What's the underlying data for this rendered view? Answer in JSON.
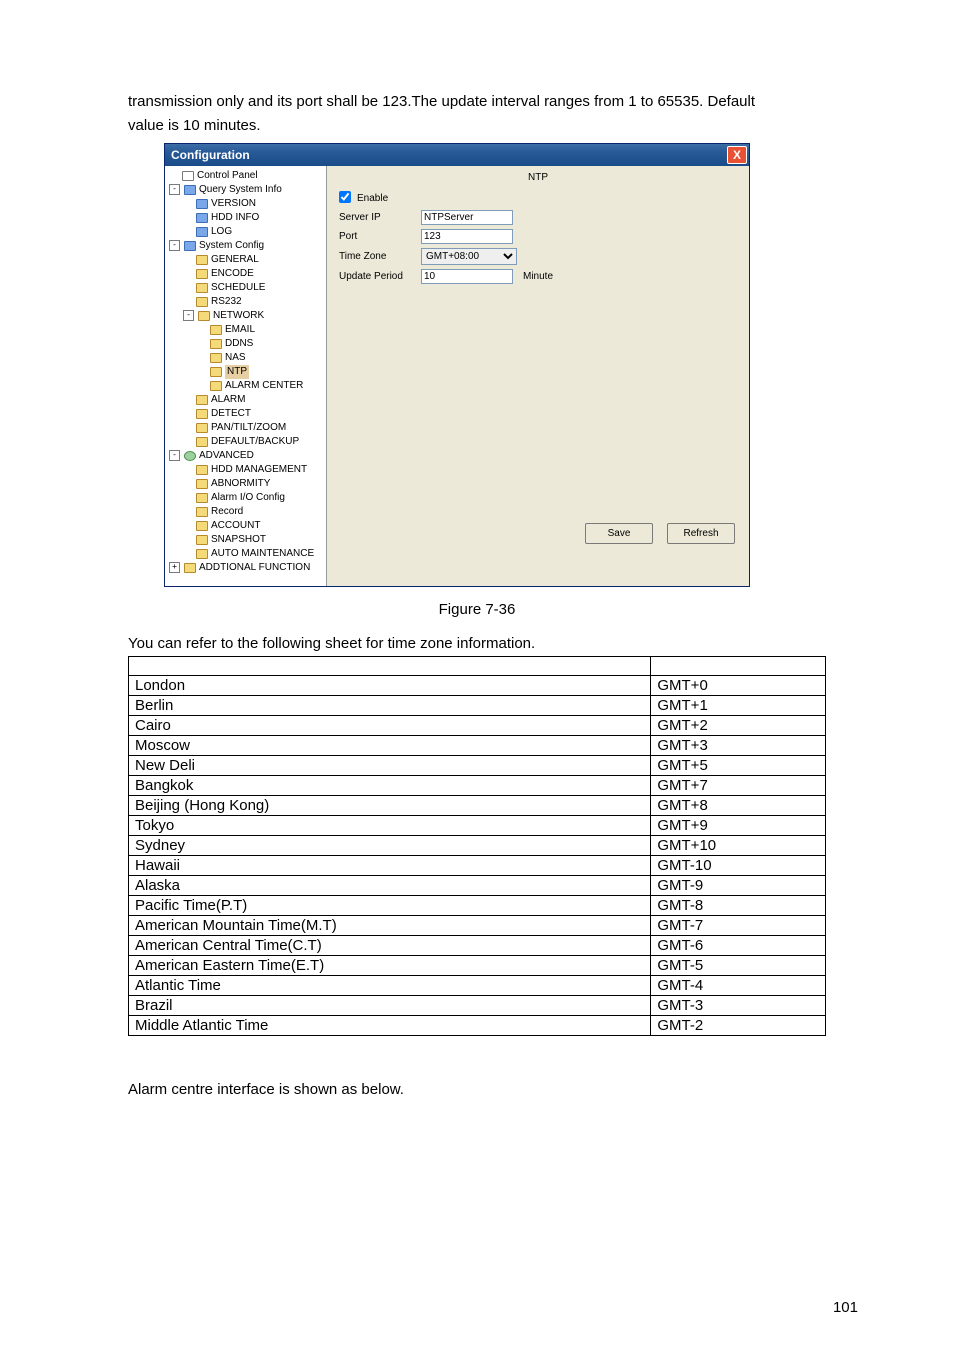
{
  "intro_text_1": "transmission only and its port shall be 123.The update interval ranges from 1 to 65535. Default",
  "intro_text_2": "value is 10 minutes.",
  "window": {
    "title": "Configuration",
    "close": "X",
    "pane_title": "NTP",
    "tree": {
      "control_panel": "Control Panel",
      "query_system_info": "Query System Info",
      "version": "VERSION",
      "hdd_info": "HDD INFO",
      "log": "LOG",
      "system_config": "System Config",
      "general": "GENERAL",
      "encode": "ENCODE",
      "schedule": "SCHEDULE",
      "rs232": "RS232",
      "network": "NETWORK",
      "email": "EMAIL",
      "ddns": "DDNS",
      "nas": "NAS",
      "ntp": "NTP",
      "alarm_center": "ALARM CENTER",
      "alarm": "ALARM",
      "detect": "DETECT",
      "pantiltzoom": "PAN/TILT/ZOOM",
      "default_backup": "DEFAULT/BACKUP",
      "advanced": "ADVANCED",
      "hdd_management": "HDD MANAGEMENT",
      "abnormity": "ABNORMITY",
      "alarm_io": "Alarm I/O Config",
      "record": "Record",
      "account": "ACCOUNT",
      "snapshot": "SNAPSHOT",
      "auto_maintenance": "AUTO MAINTENANCE",
      "additional_function": "ADDTIONAL FUNCTION"
    },
    "form": {
      "enable_label": "Enable",
      "server_ip_label": "Server IP",
      "server_ip_value": "NTPServer",
      "port_label": "Port",
      "port_value": "123",
      "timezone_label": "Time Zone",
      "timezone_value": "GMT+08:00",
      "update_period_label": "Update Period",
      "update_period_value": "10",
      "update_period_unit": "Minute"
    },
    "buttons": {
      "save": "Save",
      "refresh": "Refresh"
    }
  },
  "figure_caption": "Figure 7-36",
  "tz_intro": "You can refer to the following sheet for time zone information.",
  "tz_rows": [
    [
      "London",
      "GMT+0"
    ],
    [
      "Berlin",
      "GMT+1"
    ],
    [
      "Cairo",
      "GMT+2"
    ],
    [
      "Moscow",
      "GMT+3"
    ],
    [
      "New Deli",
      "GMT+5"
    ],
    [
      "Bangkok",
      "GMT+7"
    ],
    [
      "Beijing (Hong Kong)",
      "GMT+8"
    ],
    [
      "Tokyo",
      "GMT+9"
    ],
    [
      "Sydney",
      "GMT+10"
    ],
    [
      "Hawaii",
      "GMT-10"
    ],
    [
      "Alaska",
      "GMT-9"
    ],
    [
      "Pacific Time(P.T)",
      "GMT-8"
    ],
    [
      "American  Mountain Time(M.T)",
      "GMT-7"
    ],
    [
      "American Central Time(C.T)",
      "GMT-6"
    ],
    [
      "American Eastern Time(E.T)",
      "GMT-5"
    ],
    [
      "Atlantic Time",
      "GMT-4"
    ],
    [
      "Brazil",
      "GMT-3"
    ],
    [
      "Middle Atlantic Time",
      "GMT-2"
    ]
  ],
  "para2": "Alarm centre interface is shown as below.",
  "page_number": "101"
}
